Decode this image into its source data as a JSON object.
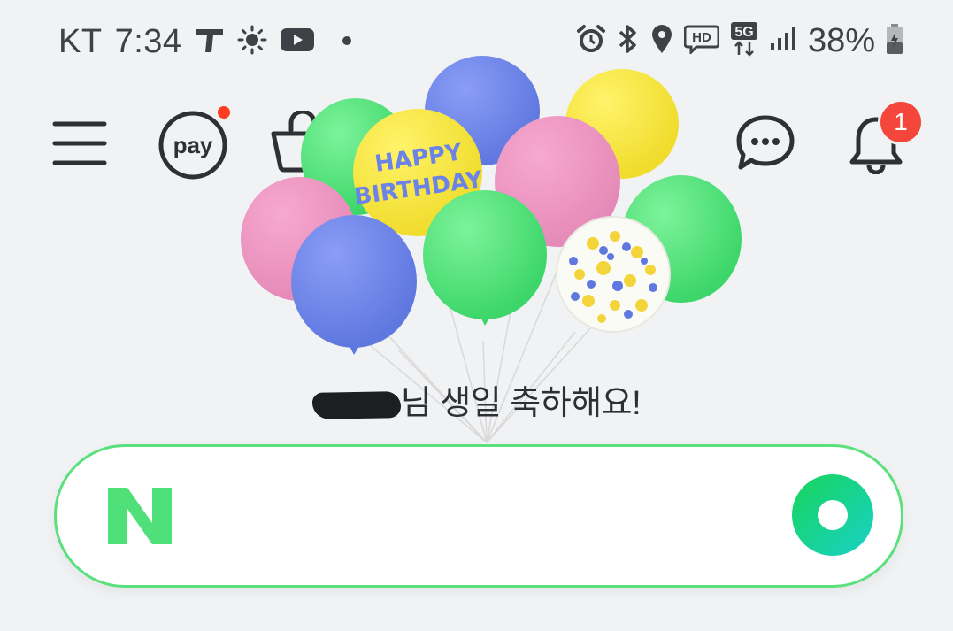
{
  "status_bar": {
    "carrier": "KT",
    "time": "7:34",
    "battery_percent": "38%",
    "network_label": "5G",
    "hd_label": "HD",
    "left_icons": [
      "t-app-icon",
      "brightness-icon",
      "youtube-icon",
      "dot-icon"
    ],
    "right_icons": [
      "alarm-icon",
      "bluetooth-icon",
      "location-icon",
      "hd-voice-icon",
      "5g-icon",
      "signal-icon",
      "battery-icon"
    ]
  },
  "top_nav": {
    "menu": "menu-icon",
    "pay_label": "pay",
    "pay_has_badge": true,
    "shopping": "shopping-bag-icon",
    "chat": "chat-icon",
    "notification_count": "1"
  },
  "birthday": {
    "balloon_text_line1": "HAPPY",
    "balloon_text_line2": "BIRTHDAY",
    "greeting_suffix": "님 생일 축하해요!"
  },
  "search": {
    "logo_letter": "N",
    "placeholder": "",
    "value": ""
  },
  "colors": {
    "background": "#f1f2f4",
    "accent_green": "#5be07e",
    "badge_red": "#f5463b"
  }
}
